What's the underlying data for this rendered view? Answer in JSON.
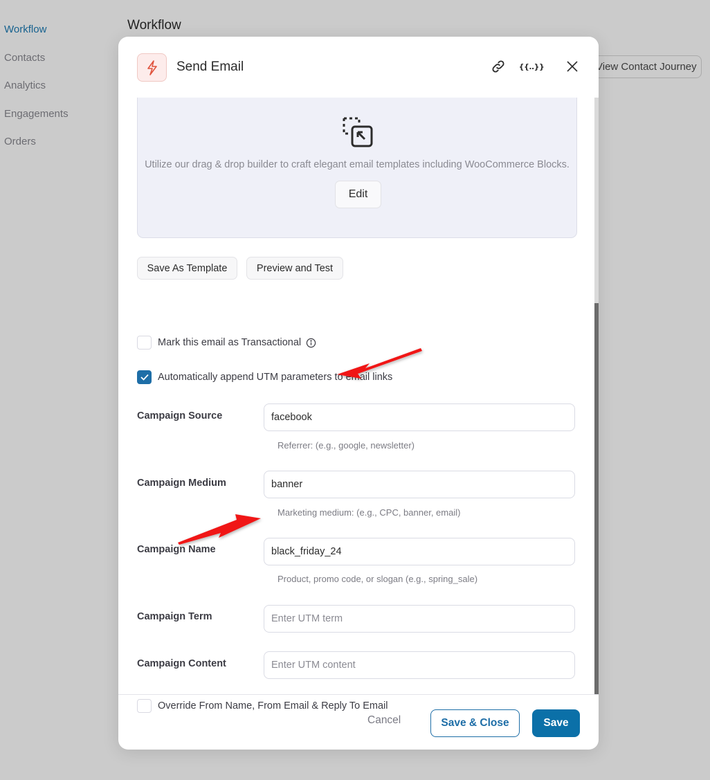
{
  "sidebar": {
    "items": [
      {
        "label": "Workflow",
        "active": true
      },
      {
        "label": "Contacts",
        "active": false
      },
      {
        "label": "Analytics",
        "active": false
      },
      {
        "label": "Engagements",
        "active": false
      },
      {
        "label": "Orders",
        "active": false
      }
    ]
  },
  "page": {
    "title": "Workflow",
    "journey_button": "View Contact Journey"
  },
  "modal": {
    "title": "Send Email",
    "icons": [
      "bolt-icon",
      "link-icon",
      "merge-tags-icon",
      "close-icon"
    ],
    "builder": {
      "description": "Utilize our drag & drop builder to craft elegant email templates including WooCommerce Blocks.",
      "edit_label": "Edit"
    },
    "actions": {
      "save_as_template": "Save As Template",
      "preview_and_test": "Preview and Test"
    },
    "transactional": {
      "label": "Mark this email as Transactional",
      "checked": false
    },
    "utm": {
      "label": "Automatically append UTM parameters to email links",
      "checked": true
    },
    "fields": {
      "source": {
        "label": "Campaign Source",
        "value": "facebook",
        "placeholder": "",
        "help": "Referrer: (e.g., google, newsletter)"
      },
      "medium": {
        "label": "Campaign Medium",
        "value": "banner",
        "placeholder": "",
        "help": "Marketing medium: (e.g., CPC, banner, email)"
      },
      "name": {
        "label": "Campaign Name",
        "value": "black_friday_24",
        "placeholder": "",
        "help": "Product, promo code, or slogan (e.g., spring_sale)"
      },
      "term": {
        "label": "Campaign Term",
        "value": "",
        "placeholder": "Enter UTM term"
      },
      "content": {
        "label": "Campaign Content",
        "value": "",
        "placeholder": "Enter UTM content"
      }
    },
    "override": {
      "label": "Override From Name, From Email & Reply To Email",
      "checked": false
    },
    "footer": {
      "cancel": "Cancel",
      "save_close": "Save & Close",
      "save": "Save"
    }
  },
  "colors": {
    "primary": "#0b70a8",
    "accent_bolt": "#e0533d",
    "annotation_arrow": "#f01515"
  }
}
